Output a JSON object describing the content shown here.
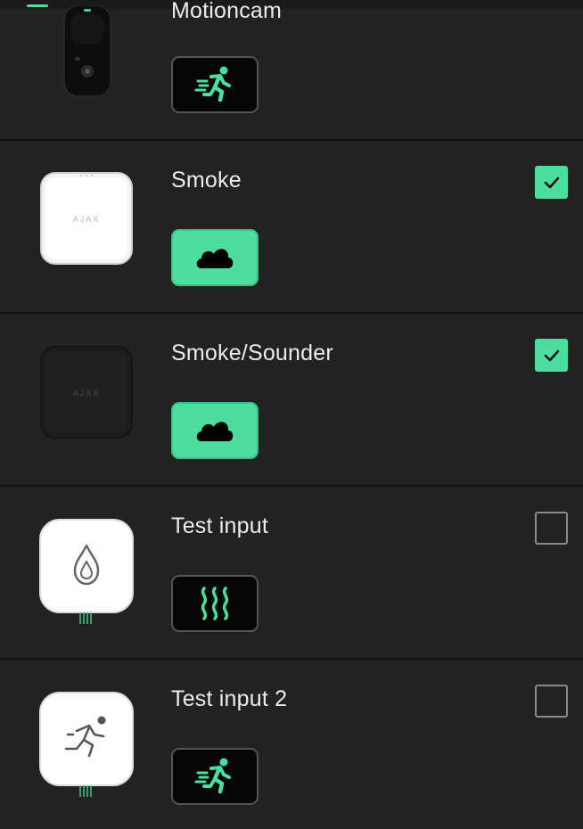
{
  "devices": [
    {
      "name": "Motioncam",
      "event_icon": "running-person-icon",
      "checked": false
    },
    {
      "name": "Smoke",
      "event_icon": "smoke-cloud-icon",
      "checked": true
    },
    {
      "name": "Smoke/Sounder",
      "event_icon": "smoke-cloud-icon",
      "checked": true
    },
    {
      "name": "Test input",
      "event_icon": "heat-waves-icon",
      "checked": false
    },
    {
      "name": "Test input 2",
      "event_icon": "running-person-icon",
      "checked": false
    }
  ],
  "device_images": {
    "smoke_logo": "AJAX",
    "sounder_logo": "AJAX"
  },
  "colors": {
    "background": "#222222",
    "accent": "#4ddd9e",
    "divider": "#111111",
    "text": "#ececec"
  }
}
